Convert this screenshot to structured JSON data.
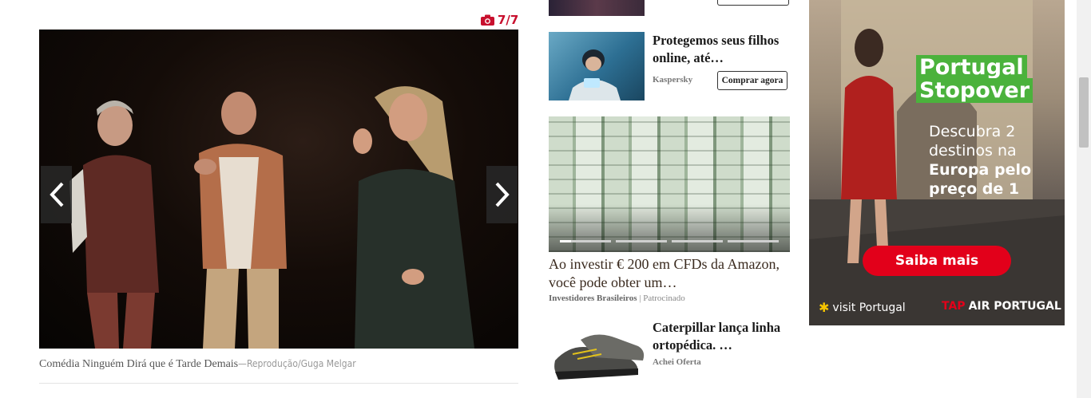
{
  "gallery": {
    "counter": "7/7",
    "caption": "Comédia Ninguém Dirá que é Tarde Demais",
    "credit": "—Reprodução/Guga Melgar",
    "prev_icon": "chevron-left-icon",
    "next_icon": "chevron-right-icon",
    "camera_icon": "camera-icon"
  },
  "sponsored": {
    "items": [
      {
        "title": "Protegemos seus filhos online, até…",
        "source": "Kaspersky",
        "button": "Comprar agora"
      },
      {
        "title": "Ao investir € 200 em CFDs da Amazon, você pode obter um…",
        "source": "Investidores Brasileiros",
        "tag": "| Patrocinado"
      },
      {
        "title": "Caterpillar lança linha ortopédica. …",
        "source": "Achei Oferta"
      }
    ]
  },
  "banner": {
    "headline_1": "Portugal",
    "headline_2": "Stopover",
    "body": [
      "Descubra 2",
      "destinos na",
      "Europa pelo",
      "preço de 1"
    ],
    "cta": "Saiba mais",
    "logo_left": "visit Portugal",
    "logo_right_prefix": "TAP",
    "logo_right": "AIR PORTUGAL",
    "colors": {
      "green": "#4bb23c",
      "red": "#e2001a"
    }
  },
  "colors": {
    "accent": "#c8102e"
  }
}
